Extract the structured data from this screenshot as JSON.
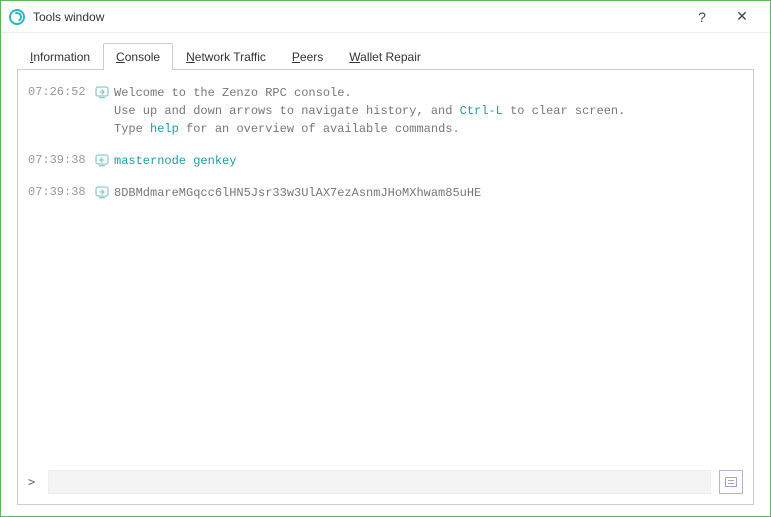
{
  "window": {
    "title": "Tools window",
    "help_glyph": "?",
    "close_glyph": "✕"
  },
  "tabs": {
    "information": "Information",
    "console": "Console",
    "network": "Network Traffic",
    "peers": "Peers",
    "wallet_repair": "Wallet Repair",
    "active": "console"
  },
  "console": {
    "entries": [
      {
        "time": "07:26:52",
        "kind": "out",
        "lines": [
          {
            "text": "Welcome to the Zenzo RPC console."
          },
          {
            "prefix": "Use up and down arrows to navigate history, and ",
            "kw": "Ctrl-L",
            "suffix": " to clear screen."
          },
          {
            "prefix": "Type ",
            "kw": "help",
            "suffix": " for an overview of available commands."
          }
        ]
      },
      {
        "time": "07:39:38",
        "kind": "in",
        "command": "masternode genkey"
      },
      {
        "time": "07:39:38",
        "kind": "out",
        "lines": [
          {
            "text": "8DBMdmareMGqcc6lHN5Jsr33w3UlAX7ezAsnmJHoMXhwam85uHE"
          }
        ]
      }
    ],
    "prompt": ">",
    "input_value": "",
    "input_placeholder": ""
  },
  "colors": {
    "accent": "#1a9ea6",
    "window_border": "#5cb85c"
  }
}
